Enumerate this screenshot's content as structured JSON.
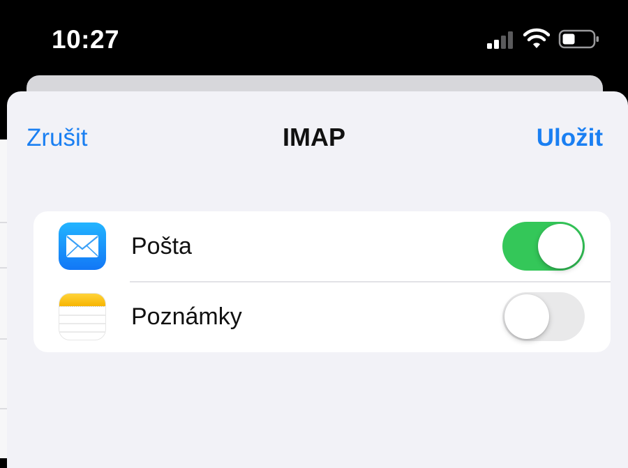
{
  "status_bar": {
    "time": "10:27",
    "signal_icon": "cellular-signal-icon",
    "wifi_icon": "wifi-icon",
    "battery_icon": "battery-icon"
  },
  "nav": {
    "cancel_label": "Zrušit",
    "title": "IMAP",
    "save_label": "Uložit"
  },
  "settings": {
    "items": [
      {
        "label": "Pošta",
        "icon": "mail-app-icon",
        "enabled": true
      },
      {
        "label": "Poznámky",
        "icon": "notes-app-icon",
        "enabled": false
      }
    ]
  },
  "colors": {
    "accent": "#1a7ff2",
    "toggle_on": "#34c759",
    "toggle_off": "#e9e9ea",
    "sheet_background": "#f2f2f7"
  }
}
